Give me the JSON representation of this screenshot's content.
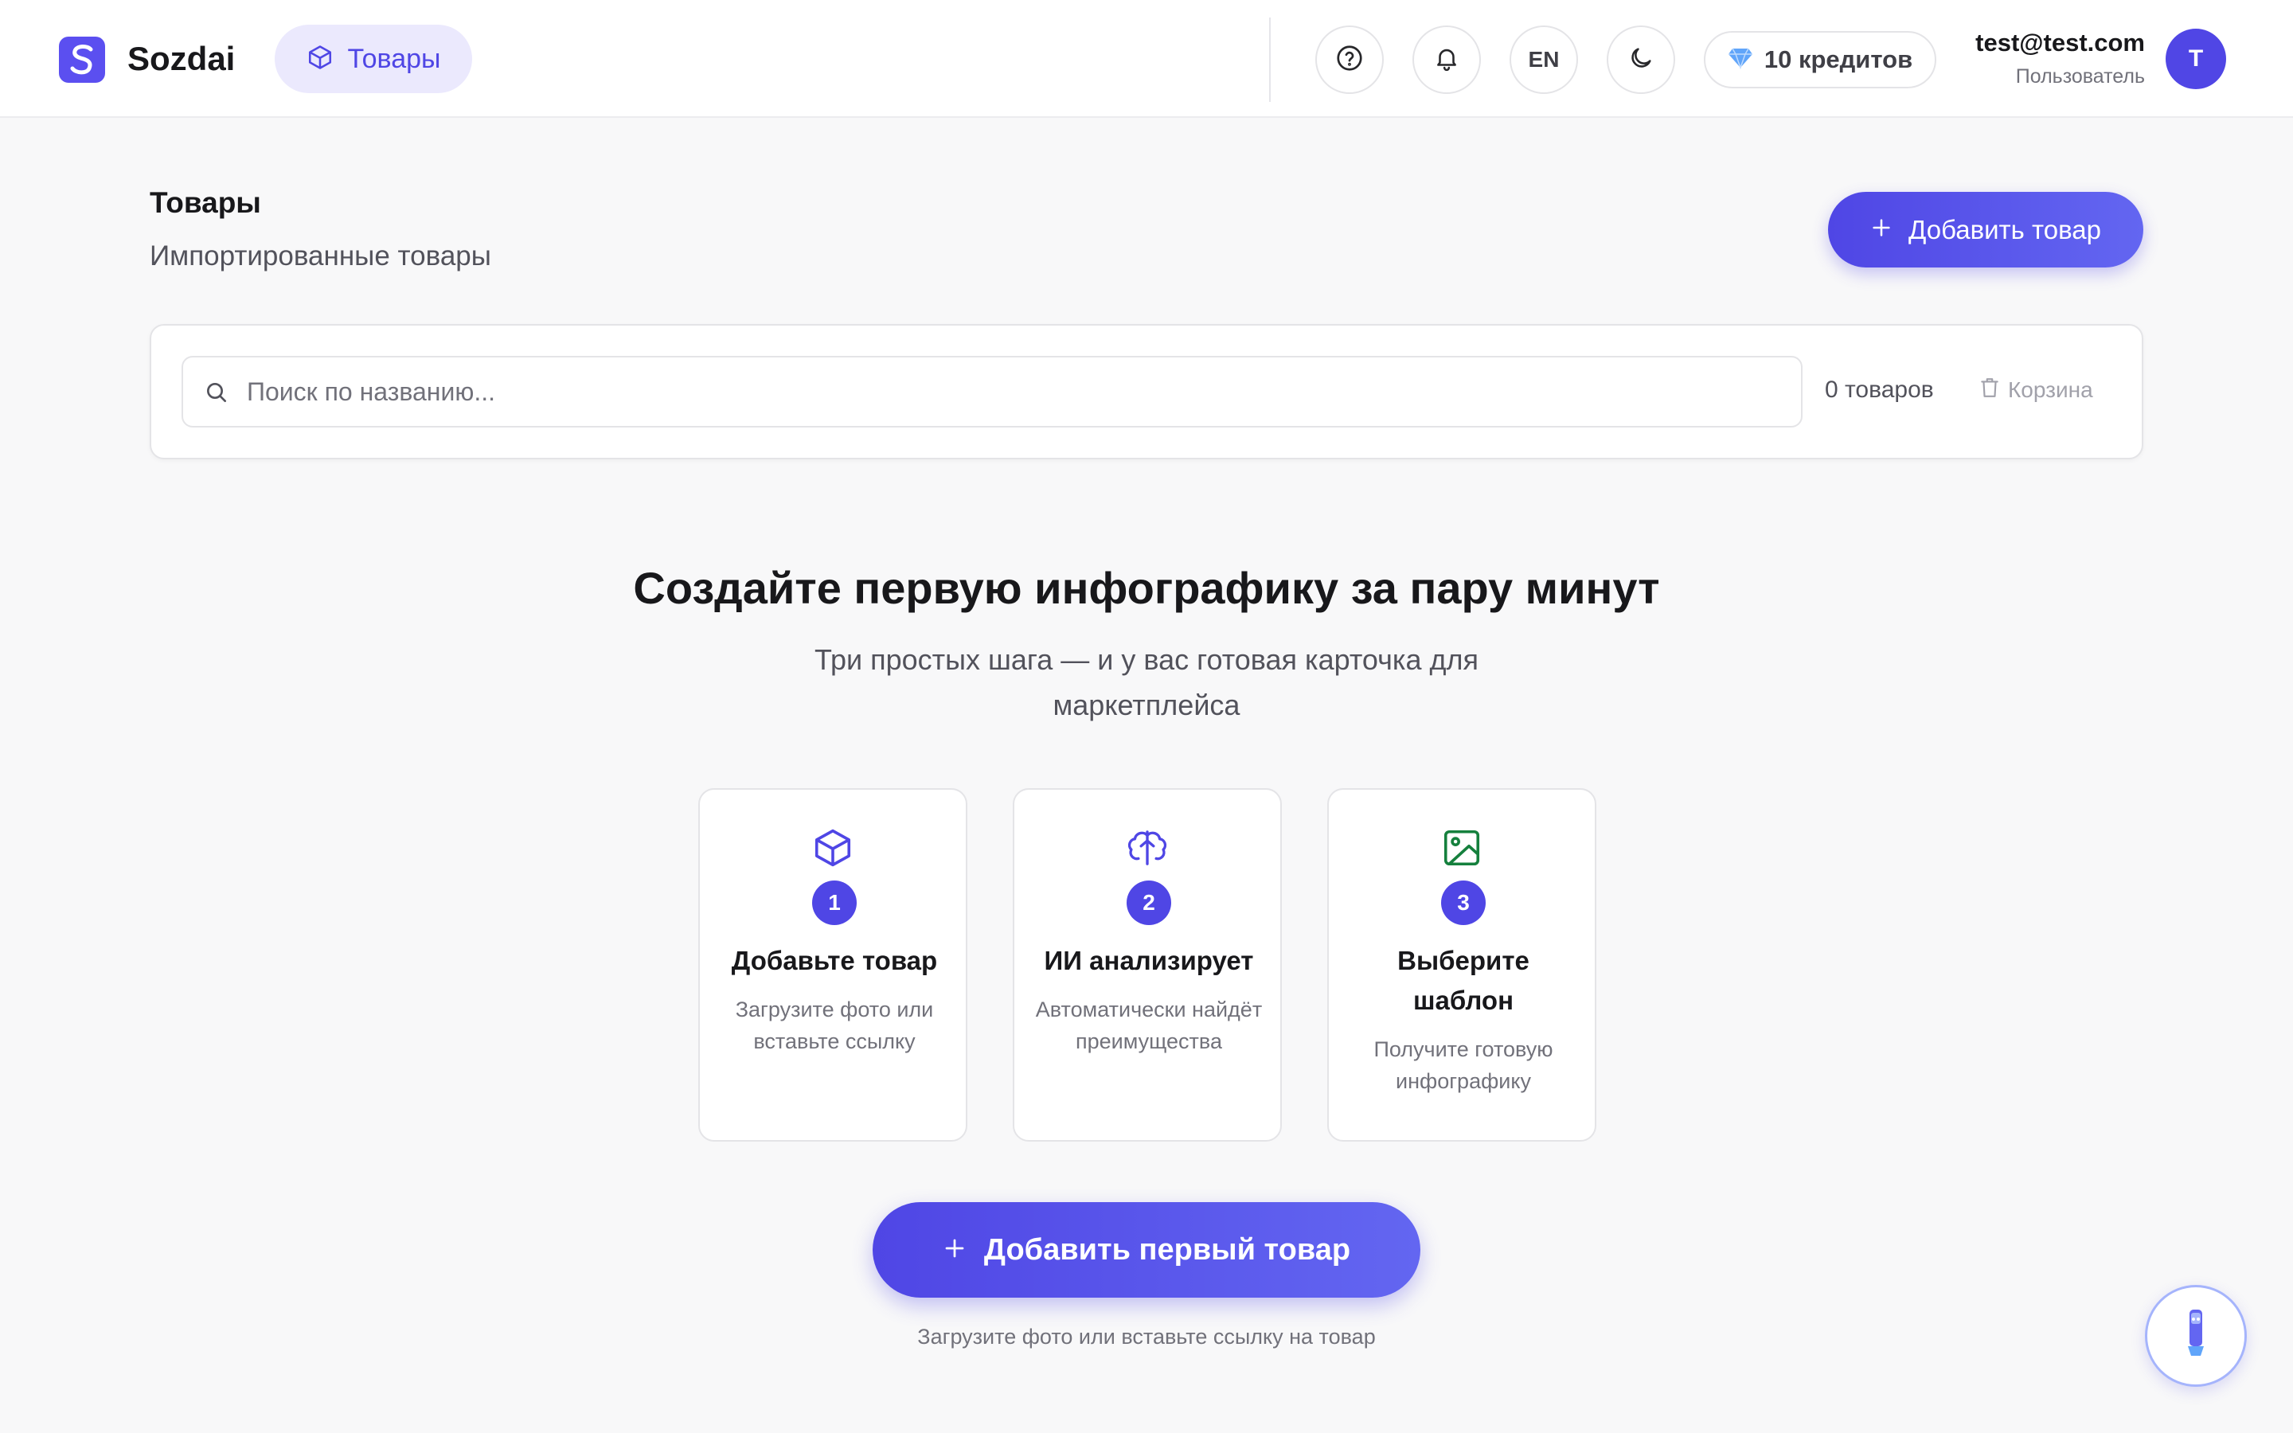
{
  "header": {
    "brand": "Sozdai",
    "nav_active": "Товары",
    "lang": "EN",
    "credits": "10 кредитов",
    "user_email": "test@test.com",
    "user_role": "Пользователь",
    "avatar_initial": "T"
  },
  "page": {
    "title": "Товары",
    "subtitle": "Импортированные товары",
    "add_button": "Добавить товар"
  },
  "search": {
    "placeholder": "Поиск по названию...",
    "value": "",
    "count": "0 товаров",
    "trash": "Корзина"
  },
  "hero": {
    "title": "Создайте первую инфографику за пару минут",
    "subtitle": "Три простых шага — и у вас готовая карточка для маркетплейса",
    "steps": [
      {
        "number": "1",
        "title": "Добавьте товар",
        "description": "Загрузите фото или вставьте ссылку",
        "icon": "cube-icon"
      },
      {
        "number": "2",
        "title": "ИИ анализирует",
        "description": "Автоматически найдёт преимущества",
        "icon": "ai-brain-icon"
      },
      {
        "number": "3",
        "title": "Выберите шаблон",
        "description": "Получите готовую инфографику",
        "icon": "image-icon"
      }
    ],
    "cta": "Добавить первый товар",
    "cta_hint": "Загрузите фото или вставьте ссылку на товар"
  },
  "colors": {
    "accent": "#4f46e5",
    "accent_light": "#ebe9fd",
    "success_icon": "#16a34a"
  }
}
